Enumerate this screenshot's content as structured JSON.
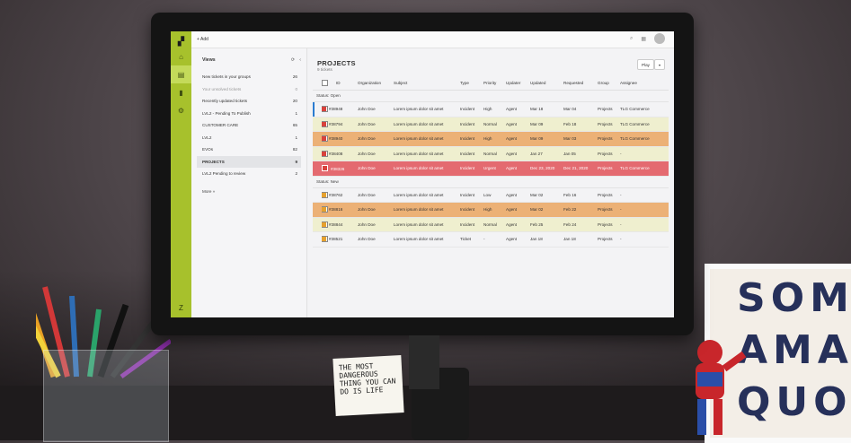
{
  "colors": {
    "rail": "#a7c12c",
    "row_yellow": "#efefcf",
    "row_orange": "#ecb176",
    "row_red": "#e46a70",
    "status_open": "#d8423c",
    "status_new": "#e6a12e"
  },
  "rail": {
    "icons": [
      "zendesk-logo-icon",
      "home-icon",
      "views-icon",
      "reporting-icon",
      "settings-icon",
      "zendesk-footer-icon"
    ]
  },
  "topbar": {
    "add_label": "+ Add",
    "icons": [
      "search-icon",
      "apps-grid-icon",
      "user-avatar-icon"
    ]
  },
  "views": {
    "title": "Views",
    "items": [
      {
        "label": "New tickets in your groups",
        "count": "26",
        "dim": false,
        "active": false
      },
      {
        "label": "Your unsolved tickets",
        "count": "0",
        "dim": true,
        "active": false
      },
      {
        "label": "Recently updated tickets",
        "count": "20",
        "dim": false,
        "active": false
      },
      {
        "label": "LVL2 - Pending To Publish",
        "count": "1",
        "dim": false,
        "active": false
      },
      {
        "label": "CUSTOMER CARE",
        "count": "65",
        "dim": false,
        "active": false
      },
      {
        "label": "LVL2",
        "count": "1",
        "dim": false,
        "active": false
      },
      {
        "label": "EVOs",
        "count": "82",
        "dim": false,
        "active": false
      },
      {
        "label": "PROJECTS",
        "count": "9",
        "dim": false,
        "active": true
      },
      {
        "label": "LVL2 Pending to review",
        "count": "2",
        "dim": false,
        "active": false
      }
    ],
    "more": "More »"
  },
  "projects": {
    "title": "PROJECTS",
    "count": "9 tickets",
    "play": "Play",
    "columns": [
      "ID",
      "Organization",
      "Subject",
      "Type",
      "Priority",
      "Updater",
      "Updated",
      "Requested",
      "Group",
      "Assignee"
    ],
    "groups": [
      {
        "status": "Status: Open",
        "rows": [
          {
            "id": "#38948",
            "org": "John Doe",
            "subject": "Lorem ipsum dolor sit amet",
            "type": "Incident",
            "priority": "High",
            "updater": "Agent",
            "updated": "Mar 18",
            "requested": "Mar 04",
            "group": "Projects",
            "assignee": "TLG Commerce",
            "bg": "none",
            "selected": true
          },
          {
            "id": "#38794",
            "org": "John Doe",
            "subject": "Lorem ipsum dolor sit amet",
            "type": "Incident",
            "priority": "Normal",
            "updater": "Agent",
            "updated": "Mar 09",
            "requested": "Feb 18",
            "group": "Projects",
            "assignee": "TLG Commerce",
            "bg": "yellow",
            "selected": false
          },
          {
            "id": "#38940",
            "org": "John Doe",
            "subject": "Lorem ipsum dolor sit amet",
            "type": "Incident",
            "priority": "High",
            "updater": "Agent",
            "updated": "Mar 09",
            "requested": "Mar 03",
            "group": "Projects",
            "assignee": "TLG Commerce",
            "bg": "orange",
            "selected": false
          },
          {
            "id": "#38408",
            "org": "John Doe",
            "subject": "Lorem ipsum dolor sit amet",
            "type": "Incident",
            "priority": "Normal",
            "updater": "Agent",
            "updated": "Jan 27",
            "requested": "Jan 05",
            "group": "Projects",
            "assignee": "-",
            "bg": "yellow",
            "selected": false
          },
          {
            "id": "#38326",
            "org": "John Doe",
            "subject": "Lorem ipsum dolor sit amet",
            "type": "Incident",
            "priority": "Urgent",
            "updater": "Agent",
            "updated": "Dec 23, 2020",
            "requested": "Dec 21, 2020",
            "group": "Projects",
            "assignee": "TLG Commerce",
            "bg": "red",
            "selected": false
          }
        ]
      },
      {
        "status": "Status: New",
        "rows": [
          {
            "id": "#38762",
            "org": "John Doe",
            "subject": "Lorem ipsum dolor sit amet",
            "type": "Incident",
            "priority": "Low",
            "updater": "Agent",
            "updated": "Mar 02",
            "requested": "Feb 16",
            "group": "Projects",
            "assignee": "-",
            "bg": "none",
            "selected": false
          },
          {
            "id": "#38816",
            "org": "John Doe",
            "subject": "Lorem ipsum dolor sit amet",
            "type": "Incident",
            "priority": "High",
            "updater": "Agent",
            "updated": "Mar 02",
            "requested": "Feb 22",
            "group": "Projects",
            "assignee": "-",
            "bg": "orange",
            "selected": false
          },
          {
            "id": "#38844",
            "org": "John Doe",
            "subject": "Lorem ipsum dolor sit amet",
            "type": "Incident",
            "priority": "Normal",
            "updater": "Agent",
            "updated": "Feb 25",
            "requested": "Feb 24",
            "group": "Projects",
            "assignee": "-",
            "bg": "yellow",
            "selected": false
          },
          {
            "id": "#38521",
            "org": "John Doe",
            "subject": "Lorem ipsum dolor sit amet",
            "type": "Ticket",
            "priority": "-",
            "updater": "Agent",
            "updated": "Jan 18",
            "requested": "Jan 18",
            "group": "Projects",
            "assignee": "-",
            "bg": "none",
            "selected": false
          }
        ]
      }
    ]
  },
  "scene": {
    "lightbox_lines": [
      "SOM",
      "AMAZ",
      "QUO"
    ],
    "note_text": "THE MOST DANGEROUS THING YOU CAN DO IS LIFE"
  }
}
